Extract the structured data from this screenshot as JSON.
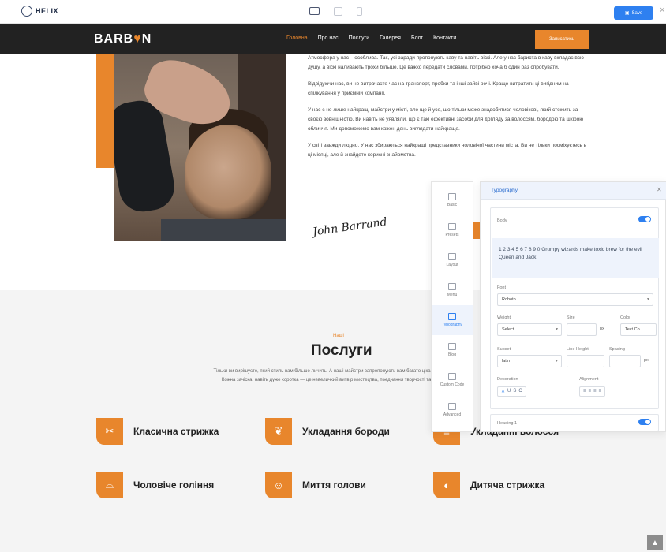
{
  "builder": {
    "logo_text": "HELIX",
    "save_label": "Save",
    "colors": {
      "accent": "#2e80f0"
    },
    "tools": [
      {
        "icon": "basic-icon",
        "label": "Basic"
      },
      {
        "icon": "presets-icon",
        "label": "Presets"
      },
      {
        "icon": "layout-icon",
        "label": "Layout"
      },
      {
        "icon": "menu-icon",
        "label": "Menu"
      },
      {
        "icon": "typography-icon",
        "label": "Typography"
      },
      {
        "icon": "blog-icon",
        "label": "Blog"
      },
      {
        "icon": "code-icon",
        "label": "Custom Code"
      },
      {
        "icon": "advanced-icon",
        "label": "Advanced"
      }
    ],
    "panel": {
      "title": "Typography",
      "body_label": "Body",
      "preview_text": "1 2 3 4 5 6 7 8 9 0 Grumpy wizards make toxic brew for the evil Queen and Jack.",
      "font_label": "Font",
      "font_value": "Roboto",
      "weight_label": "Weight",
      "weight_value": "Select",
      "size_label": "Size",
      "size_unit": "px",
      "color_label": "Color",
      "color_placeholder": "Text Co",
      "subset_label": "Subset",
      "subset_value": "latin",
      "line_height_label": "Line Height",
      "spacing_label": "Spacing",
      "spacing_unit": "px",
      "decoration_label": "Decoration",
      "alignment_label": "Alignment",
      "heading_label": "Heading 1"
    }
  },
  "site": {
    "brand": "BARB",
    "brand_end": "N",
    "nav": [
      "Головна",
      "Про нас",
      "Послуги",
      "Галерея",
      "Блог",
      "Контакти"
    ],
    "cta": "Записатись",
    "colors": {
      "accent": "#e8862c",
      "dark": "#222222"
    },
    "about": {
      "paragraphs": [
        "Атмосфера у нас – особлива. Так, усі заради пропонують каву та навіть віскі. Але у нас бариста в каву вкладає всю душу, а віскі наливають трохи більше. Це важко передати словами, потрібно хоча б один раз спробувати.",
        "Відвідуючи нас, ви не витрачаєте час на транспорт, пробки та інші зайві речі. Краще витратити ці вигідним на спілкування у приємній компанії.",
        "У нас є не лише найкращі майстри у місті, але ще й усе, що тільки може знадобитися чоловікові, який стежить за своєю зовнішністю. Ви навіть не уявляли, що є такі ефективні засоби для догляду за волоссям, бородою та шкірою обличчя. Ми допоможемо вам кожен день виглядати найкраще.",
        "У світі завжди людно. У нас збираються найкращі представники чоловічої частини міста. Ви не тільки посміхуєтесь в ці місяці, але й знайдете корисні знайомства."
      ],
      "signature": "John Barrand"
    },
    "services": {
      "kicker": "Наші",
      "title": "Послуги",
      "description": "Тільки ви вирішуєте, який стиль вам більше личить. А наші майстри запропонують вам багато цікавих варіантів. Кожна зачіска, навіть дуже коротка — це невеличкий витвір мистецтва, поєднання творчості та природи.",
      "items": [
        {
          "label": "Класична стрижка",
          "icon": "scissors-icon"
        },
        {
          "label": "Укладання бороди",
          "icon": "beard-icon"
        },
        {
          "label": "Укладанні волосся",
          "icon": "comb-icon"
        },
        {
          "label": "Чоловіче гоління",
          "icon": "razor-icon"
        },
        {
          "label": "Миття голови",
          "icon": "head-wash-icon"
        },
        {
          "label": "Дитяча стрижка",
          "icon": "kid-icon"
        }
      ]
    }
  }
}
